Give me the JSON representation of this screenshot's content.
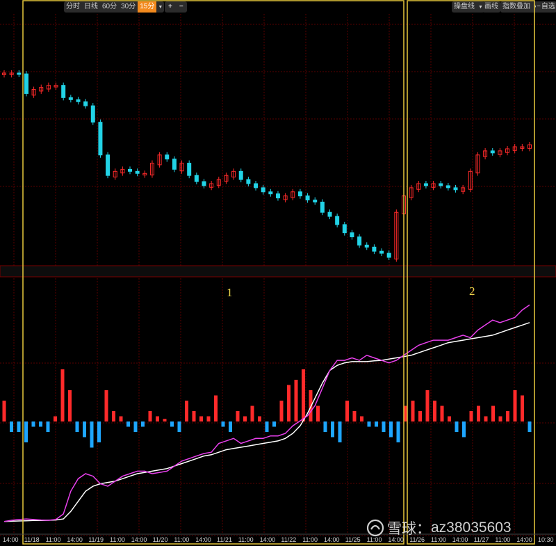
{
  "toolbar": {
    "periods": [
      "分时",
      "日线",
      "60分",
      "30分",
      "15分"
    ],
    "active_period": "15分",
    "zoom_in": "+",
    "zoom_out": "−",
    "right_buttons": [
      "操盘线",
      "画线",
      "指数叠加"
    ],
    "self_select": "自选"
  },
  "watermark": {
    "brand": "雪球",
    "separator": "：",
    "user": "az38035603"
  },
  "colors": {
    "up": "#ff2a2a",
    "down": "#22d3e6",
    "fast_line": "#e840ec",
    "slow_line": "#ffffff",
    "zone_border": "#e8c93c",
    "grid": "#5a0000"
  },
  "chart_data": {
    "type": "candlestick_with_indicator",
    "x_axis_labels": [
      "14:00",
      "11/18",
      "11:00",
      "14:00",
      "11/19",
      "11:00",
      "14:00",
      "11/20",
      "11:00",
      "14:00",
      "11/21",
      "11:00",
      "14:00",
      "11/22",
      "11:00",
      "14:00",
      "11/25",
      "11:00",
      "14:00",
      "11/26",
      "11:00",
      "14:00",
      "11/27",
      "11:00",
      "14:00",
      "10:30"
    ],
    "annotations": [
      "1",
      "2"
    ],
    "candle_trend": [
      100,
      100,
      99.8,
      95,
      96,
      96.5,
      97,
      97,
      94,
      93.5,
      93,
      92,
      88,
      80,
      75,
      76,
      76.5,
      76,
      75.5,
      75.5,
      78,
      80,
      79,
      76.5,
      78,
      75,
      73.5,
      72.5,
      73,
      74,
      75,
      76,
      74,
      73,
      72,
      71,
      70.5,
      69.5,
      70,
      71,
      70,
      69,
      68.5,
      66,
      65,
      63,
      61,
      60,
      58,
      57.5,
      56.5,
      56,
      55,
      66,
      70,
      72,
      73,
      72.5,
      73,
      72.5,
      72,
      71.5,
      72,
      76,
      80,
      81,
      80.5,
      81,
      81.5,
      82,
      82,
      82.5
    ],
    "histogram": [
      4,
      -2,
      -2,
      -4,
      -1,
      -1,
      -2,
      1,
      10,
      6,
      -2,
      -3,
      -5,
      -4,
      6,
      2,
      1,
      -1,
      -2,
      -1,
      2,
      1,
      0.5,
      -1,
      -2,
      4,
      2,
      1,
      1,
      5,
      -1,
      -2,
      2,
      1,
      3,
      1,
      -2,
      -1,
      4,
      7,
      8,
      10,
      6,
      3,
      -2,
      -3,
      -4,
      4,
      2,
      1,
      -1,
      -1,
      -2,
      -3,
      -4,
      3,
      4,
      2,
      6,
      4,
      3,
      1,
      -2,
      -3,
      2,
      3,
      1,
      3,
      1,
      2,
      6,
      5,
      -2
    ],
    "indicator_fast": [
      2,
      2.5,
      2.8,
      3,
      2.8,
      2.6,
      2.5,
      2.8,
      5,
      14,
      19,
      21,
      20,
      17,
      16,
      18,
      20,
      21,
      22,
      22,
      21,
      21.5,
      22,
      24,
      26,
      27,
      28,
      29,
      29.5,
      33,
      34,
      35,
      33,
      34,
      35,
      35,
      36,
      36,
      37,
      40,
      42,
      44,
      48,
      55,
      62,
      66,
      66,
      67,
      66,
      68,
      67,
      66,
      65,
      66,
      68,
      70,
      72,
      73,
      74,
      74,
      74,
      75,
      76,
      75,
      78,
      80,
      82,
      81,
      82,
      83,
      86,
      88
    ],
    "indicator_slow": [
      2,
      2.1,
      2.2,
      2.3,
      2.4,
      2.4,
      2.5,
      2.6,
      3,
      6,
      10,
      14,
      16,
      17,
      17.5,
      18,
      19,
      20,
      21,
      21.5,
      22,
      22.5,
      23,
      24,
      25,
      26,
      27,
      28,
      28.5,
      29.5,
      30.5,
      31,
      31.5,
      32,
      32.5,
      33,
      33.5,
      34,
      35,
      37,
      40,
      45,
      51,
      57,
      62,
      64,
      65,
      65.5,
      65.5,
      65.5,
      65.8,
      66,
      66.5,
      67,
      67.5,
      68,
      69,
      70,
      71,
      72,
      73,
      73.5,
      74,
      74.5,
      75,
      75.5,
      76,
      77,
      78,
      79,
      80,
      81
    ]
  }
}
